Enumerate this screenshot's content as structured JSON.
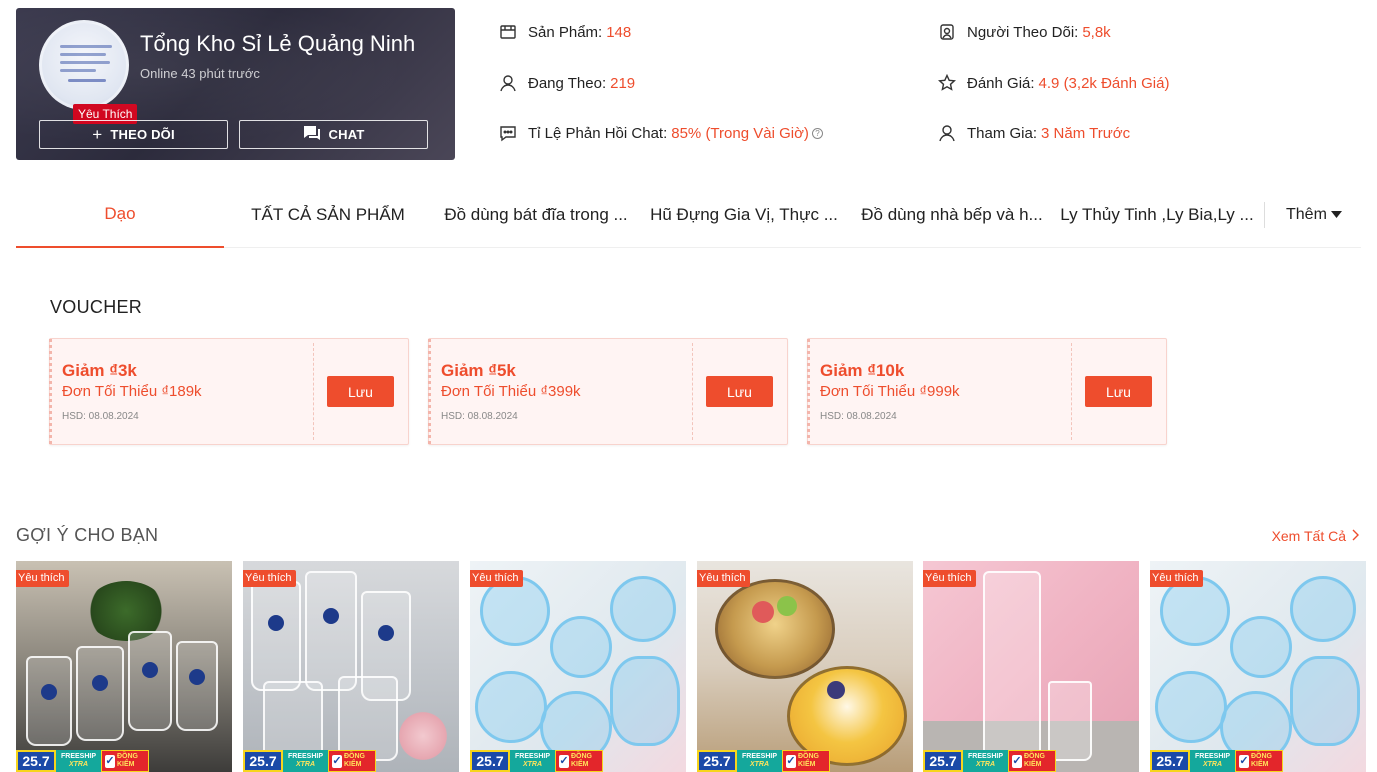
{
  "shop": {
    "name": "Tổng Kho Sỉ Lẻ Quảng Ninh",
    "online": "Online 43 phút trước",
    "badge": "Yêu Thích",
    "follow_label": "THEO DÕI",
    "chat_label": "CHAT"
  },
  "stats": {
    "products_label": "Sản Phẩm:",
    "products_value": "148",
    "following_label": "Đang Theo:",
    "following_value": "219",
    "chat_rate_label": "Tỉ Lệ Phản Hồi Chat:",
    "chat_rate_value": "85% (Trong Vài Giờ)",
    "followers_label": "Người Theo Dõi:",
    "followers_value": "5,8k",
    "rating_label": "Đánh Giá:",
    "rating_value": "4.9 (3,2k Đánh Giá)",
    "joined_label": "Tham Gia:",
    "joined_value": "3 Năm Trước",
    "icons": [
      "shop-icon",
      "user-icon",
      "chat-bubble-icon",
      "followers-icon",
      "star-icon",
      "user-icon"
    ]
  },
  "tabs": [
    {
      "label": "Dạo"
    },
    {
      "label": "TẤT CẢ SẢN PHẨM"
    },
    {
      "label": "Đồ dùng bát đĩa trong ..."
    },
    {
      "label": "Hũ Đựng Gia Vị, Thực ..."
    },
    {
      "label": "Đồ dùng nhà bếp và h..."
    },
    {
      "label": "Ly Thủy Tinh ,Ly Bia,Ly ..."
    }
  ],
  "tabs_more": "Thêm",
  "voucher": {
    "title": "VOUCHER",
    "items": [
      {
        "amount": "Giảm ₫3k",
        "min": "Đơn Tối Thiểu ₫189k",
        "expiry": "HSD: 08.08.2024",
        "button": "Lưu"
      },
      {
        "amount": "Giảm ₫5k",
        "min": "Đơn Tối Thiểu ₫399k",
        "expiry": "HSD: 08.08.2024",
        "button": "Lưu"
      },
      {
        "amount": "Giảm ₫10k",
        "min": "Đơn Tối Thiểu ₫999k",
        "expiry": "HSD: 08.08.2024",
        "button": "Lưu"
      }
    ]
  },
  "suggestions": {
    "title": "GỢI Ý CHO BẠN",
    "see_all": "Xem Tất Cả",
    "badge": "Yêu thích",
    "promo": {
      "date": "25.7",
      "free_top": "FREESHIP",
      "free_bottom": "XTRA",
      "check": "ĐỒNG KIỂM"
    }
  },
  "colors": {
    "accent": "#ee4d2d",
    "header_bg": "#2f2e40"
  }
}
